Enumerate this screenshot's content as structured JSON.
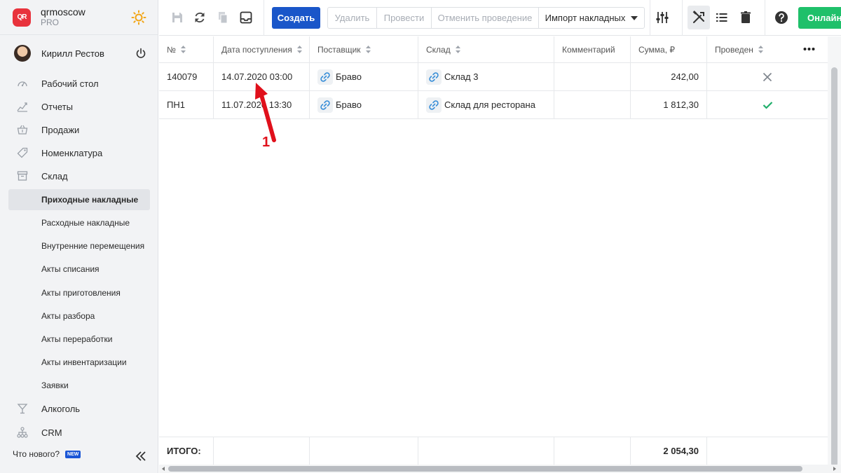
{
  "brand": {
    "name": "qrmoscow",
    "plan": "PRO",
    "logo_text": "QR"
  },
  "user": {
    "name": "Кирилл Рестов"
  },
  "nav": {
    "items": [
      {
        "label": "Рабочий стол",
        "icon": "dashboard-icon"
      },
      {
        "label": "Отчеты",
        "icon": "reports-icon"
      },
      {
        "label": "Продажи",
        "icon": "basket-icon"
      },
      {
        "label": "Номенклатура",
        "icon": "tag-icon"
      },
      {
        "label": "Склад",
        "icon": "warehouse-icon"
      }
    ],
    "sub_items": [
      "Приходные накладные",
      "Расходные накладные",
      "Внутренние перемещения",
      "Акты списания",
      "Акты приготовления",
      "Акты разбора",
      "Акты переработки",
      "Акты инвентаризации",
      "Заявки"
    ],
    "bottom_items": [
      {
        "label": "Алкоголь",
        "icon": "cocktail-icon"
      },
      {
        "label": "CRM",
        "icon": "org-chart-icon"
      }
    ],
    "whats_new": "Что нового?",
    "new_badge": "NEW"
  },
  "toolbar": {
    "create": "Создать",
    "delete": "Удалить",
    "post": "Провести",
    "unpost": "Отменить проведение",
    "import": "Импорт накладных",
    "online": "Онлайн"
  },
  "table": {
    "columns": [
      "№",
      "Дата поступления",
      "Поставщик",
      "Склад",
      "Комментарий",
      "Сумма, ₽",
      "Проведен"
    ],
    "rows": [
      {
        "number": "140079",
        "date": "14.07.2020 03:00",
        "supplier": "Браво",
        "warehouse": "Склад 3",
        "comment": "",
        "sum": "242,00",
        "posted": false
      },
      {
        "number": "ПН1",
        "date": "11.07.2020 13:30",
        "supplier": "Браво",
        "warehouse": "Склад для ресторана",
        "comment": "",
        "sum": "1 812,30",
        "posted": true
      }
    ],
    "total_label": "ИТОГО:",
    "total_sum": "2 054,30"
  },
  "annotation": {
    "label": "1"
  },
  "colors": {
    "primary": "#1a56c9",
    "success": "#1fc06a",
    "accent_red": "#e0101b",
    "check": "#1fae6a"
  }
}
